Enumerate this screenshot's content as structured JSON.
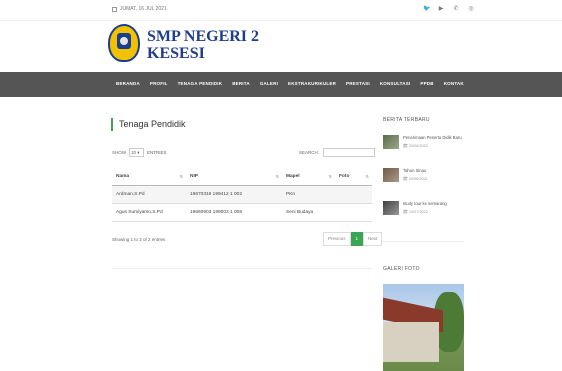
{
  "topbar": {
    "date": "JUMAT, 16 JUL 2021",
    "socials": [
      "twitter-icon",
      "youtube-icon",
      "phone-icon",
      "instagram-icon"
    ]
  },
  "brand": {
    "line1": "SMP NEGERI 2",
    "line2": "KESESI"
  },
  "nav": [
    "BERANDA",
    "PROFIL",
    "TENAGA PENDIDIK",
    "BERITA",
    "GALERI",
    "EKSTRAKURIKULER",
    "PRESTASI",
    "KONSULTASI",
    "PPDB",
    "KONTAK"
  ],
  "main": {
    "title": "Tenaga Pendidik",
    "show_label": "SHOW",
    "entries_value": "10",
    "entries_label": "ENTRIES",
    "search_label": "SEARCH:",
    "search_placeholder": "",
    "columns": [
      "Nama",
      "NIP",
      "Mapel",
      "Foto"
    ],
    "rows": [
      [
        "Ardman,S.Pd",
        "19670319 199412 1 002",
        "PKn",
        ""
      ],
      [
        "Agus Sumiyarso,S.Pd",
        "19660603 199003 1 008",
        "Seni Budaya",
        ""
      ]
    ],
    "info": "Showing 1 to 2 of 2 entries",
    "pager": [
      "Previous",
      "1",
      "Next"
    ]
  },
  "sidebar": {
    "news_title": "BERITA TERBARU",
    "news": [
      {
        "title": "Penerimaan Peserta Didik Baru",
        "date": "20/06/2022"
      },
      {
        "title": "Tahun Sinau",
        "date": "20/06/2021"
      },
      {
        "title": "study tour ke semarang",
        "date": "10/07/2022"
      }
    ],
    "gallery_title": "GALERI FOTO"
  },
  "colors": {
    "accent": "#3aa655",
    "nav_bg": "#555555",
    "brand": "#1f3d8a"
  }
}
